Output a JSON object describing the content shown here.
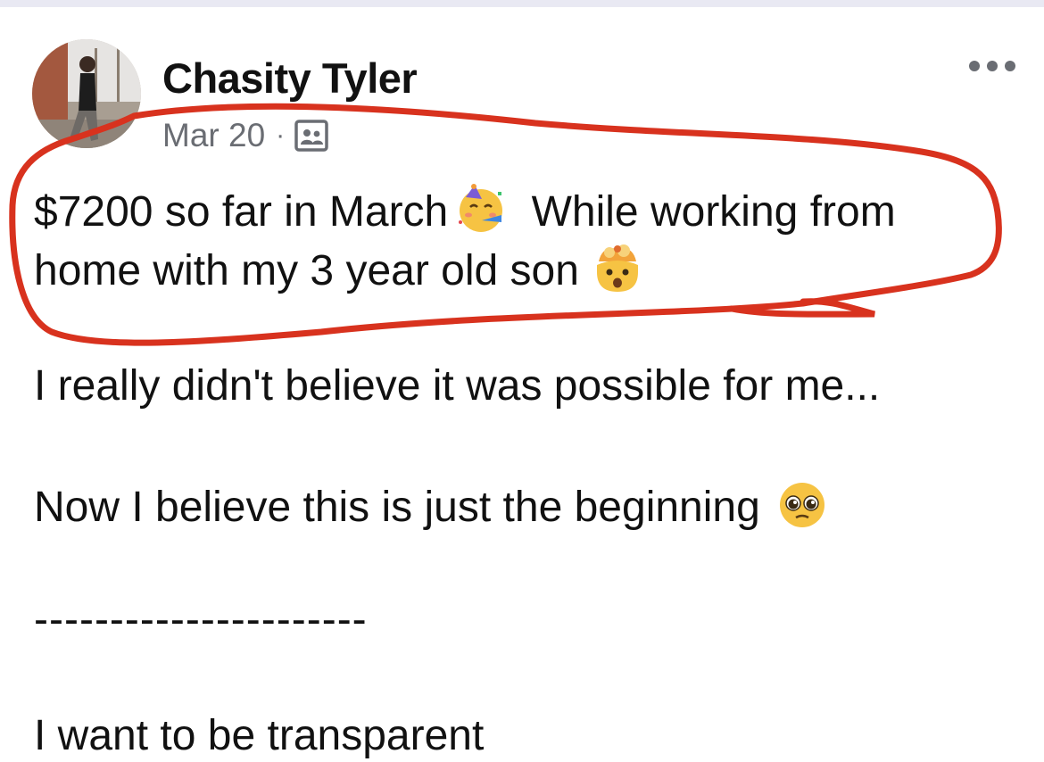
{
  "post": {
    "author_name": "Chasity Tyler",
    "date": "Mar 20",
    "separator": "·",
    "audience_icon": "friends-audience-icon",
    "more_icon": "more-options-icon",
    "lines": [
      "$7200 so far in March",
      "While working from",
      "home with my 3 year old son",
      "I really didn't believe it was possible for me...",
      "Now I believe this is just the beginning",
      "----------------------",
      "I want to be transparent"
    ],
    "emojis": [
      "partying-face-emoji",
      "exploding-head-emoji",
      "pleading-face-emoji"
    ]
  },
  "colors": {
    "highlight": "#d8321e",
    "meta_text": "#6a6d73",
    "top_strip": "#e9e9f3"
  }
}
